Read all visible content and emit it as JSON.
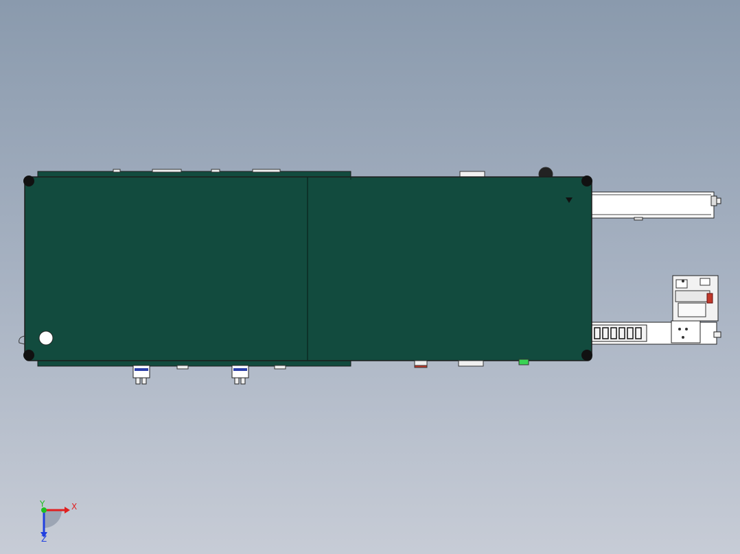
{
  "viewport": {
    "background_top": "#8a9aad",
    "background_bottom": "#c7ccd6"
  },
  "model": {
    "panel_color": "#124b3e",
    "outline_color": "#1c1c1c",
    "rail_color": "#ffffff",
    "accent_red": "#c0392b",
    "accent_green": "#39d353",
    "accent_blue": "#2b3fa8"
  },
  "triad": {
    "x_label": "X",
    "y_label": "Y",
    "z_label": "Z",
    "x_color": "#e02020",
    "y_color": "#20c020",
    "z_color": "#2040e0"
  }
}
